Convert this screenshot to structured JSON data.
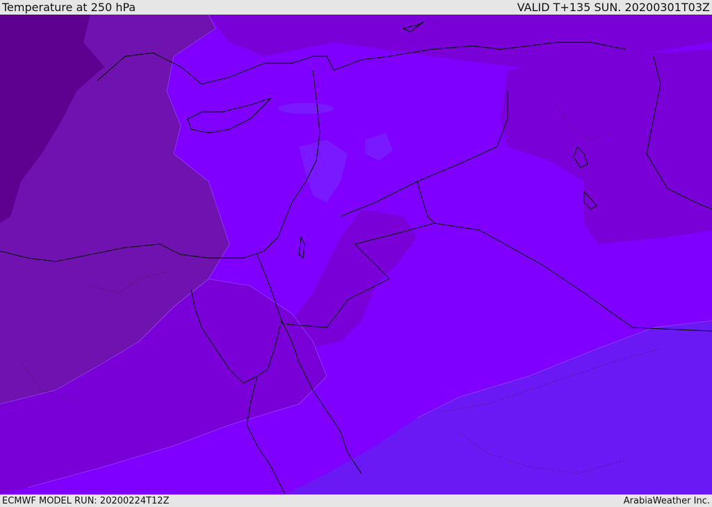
{
  "header": {
    "title": "Temperature at 250 hPa",
    "valid": "VALID T+135 SUN. 20200301T03Z"
  },
  "footer": {
    "model_run": "ECMWF MODEL RUN: 20200224T12Z",
    "credit": "ArabiaWeather Inc."
  },
  "map": {
    "field": "temperature",
    "level": "250 hPa",
    "colors": {
      "coldest": "#5e0090",
      "colder": "#7012b0",
      "cold": "#7a00d8",
      "mid": "#7f00ff",
      "light": "#7a18ff",
      "warm": "#6a18f4",
      "border": "#000000",
      "contour": "#9a5cff"
    }
  }
}
